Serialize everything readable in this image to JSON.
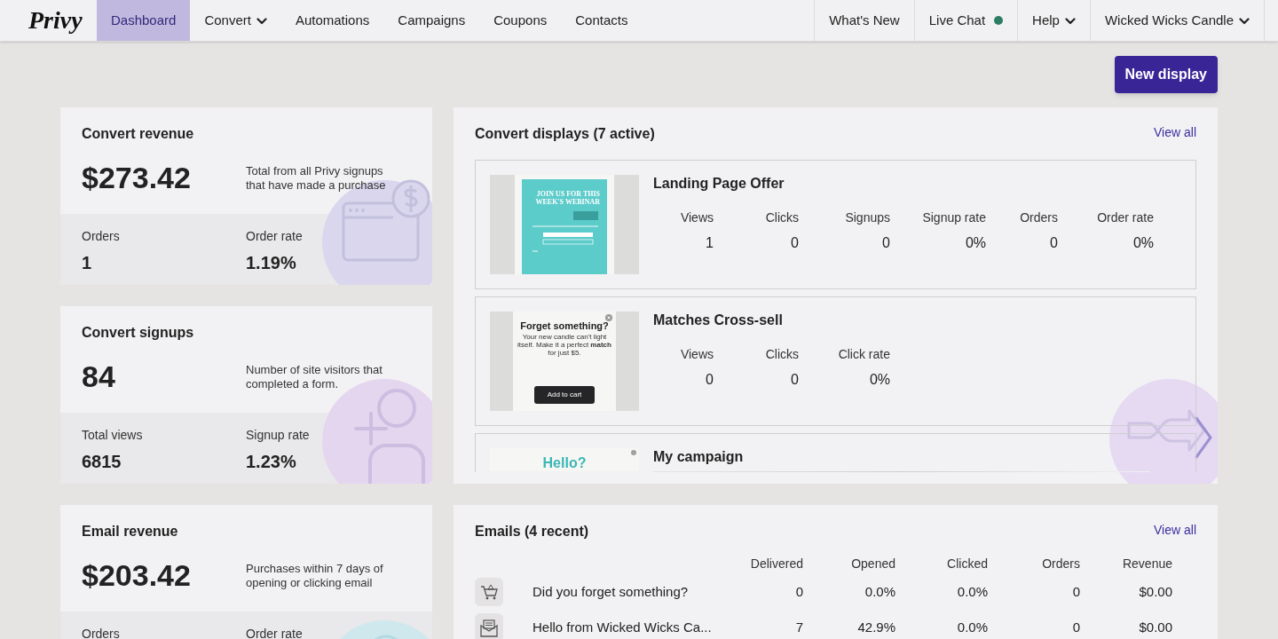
{
  "nav": {
    "logo": "Privy",
    "items": [
      {
        "label": "Dashboard",
        "selected": true,
        "dropdown": false
      },
      {
        "label": "Convert",
        "selected": false,
        "dropdown": true
      },
      {
        "label": "Automations",
        "selected": false,
        "dropdown": false
      },
      {
        "label": "Campaigns",
        "selected": false,
        "dropdown": false
      },
      {
        "label": "Coupons",
        "selected": false,
        "dropdown": false
      },
      {
        "label": "Contacts",
        "selected": false,
        "dropdown": false
      }
    ],
    "right_items": [
      {
        "label": "What's New",
        "dropdown": false,
        "online": false
      },
      {
        "label": "Live Chat",
        "dropdown": false,
        "online": true
      },
      {
        "label": "Help",
        "dropdown": true,
        "online": false
      },
      {
        "label": "Wicked Wicks Candle",
        "dropdown": true,
        "online": false
      }
    ]
  },
  "new_display_button": "New display",
  "stat_cards": [
    {
      "kind": "browser-dollar",
      "title": "Convert revenue",
      "value": "$273.42",
      "description": "Total from all Privy signups that have made a purchase",
      "metrics": [
        {
          "label": "Orders",
          "value": "1"
        },
        {
          "label": "Order rate",
          "value": "1.19%"
        }
      ]
    },
    {
      "kind": "add-user",
      "title": "Convert signups",
      "value": "84",
      "description": "Number of site visitors that completed a form.",
      "metrics": [
        {
          "label": "Total views",
          "value": "6815"
        },
        {
          "label": "Signup rate",
          "value": "1.23%"
        }
      ]
    },
    {
      "kind": "mail-dollar",
      "title": "Email revenue",
      "value": "$203.42",
      "description": "Purchases within 7 days of opening or clicking email",
      "metrics": [
        {
          "label": "Orders"
        },
        {
          "label": "Order rate"
        }
      ]
    }
  ],
  "displays": {
    "title": "Convert displays (7 active)",
    "link": "View all",
    "items": [
      {
        "name": "Landing Page Offer",
        "preview": {
          "kind": "webinar",
          "heading": "JOIN US FOR THIS WEEK'S WEBINAR"
        },
        "stats": [
          {
            "label": "Views",
            "value": "1"
          },
          {
            "label": "Clicks",
            "value": "0"
          },
          {
            "label": "Signups",
            "value": "0"
          },
          {
            "label": "Signup rate",
            "value": "0%"
          },
          {
            "label": "Orders",
            "value": "0"
          },
          {
            "label": "Order rate",
            "value": "0%"
          }
        ]
      },
      {
        "name": "Matches Cross-sell",
        "preview": {
          "kind": "popup",
          "heading": "Forget something?",
          "body": "Your new candle can't light itself. Make it a perfect **match** for just $5.",
          "button": "Add to cart"
        },
        "stats": [
          {
            "label": "Views",
            "value": "0"
          },
          {
            "label": "Clicks",
            "value": "0"
          },
          {
            "label": "Click rate",
            "value": "0%"
          }
        ]
      },
      {
        "name": "My campaign",
        "preview": {
          "kind": "hello",
          "heading": "Hello?"
        }
      }
    ]
  },
  "emails": {
    "title": "Emails (4 recent)",
    "link": "View all",
    "columns": [
      "Delivered",
      "Opened",
      "Clicked",
      "Orders",
      "Revenue"
    ],
    "rows": [
      {
        "kind": "cart",
        "name": "Did you forget something?",
        "cells": [
          "0",
          "0.0%",
          "0.0%",
          "0",
          "$0.00"
        ]
      },
      {
        "kind": "mail",
        "name": "Hello from Wicked Wicks Ca...",
        "cells": [
          "7",
          "42.9%",
          "0.0%",
          "0",
          "$0.00"
        ]
      }
    ]
  }
}
